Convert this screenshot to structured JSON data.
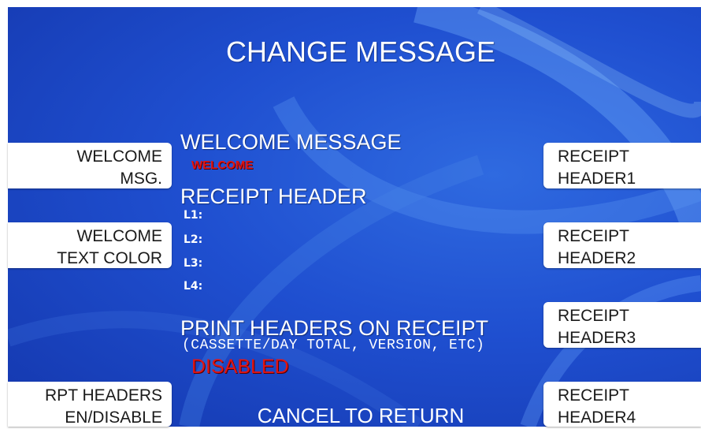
{
  "screen": {
    "title": "CHANGE MESSAGE",
    "footer": "CANCEL TO RETURN"
  },
  "welcome": {
    "heading": "WELCOME MESSAGE",
    "value": "WELCOME"
  },
  "receipt_header": {
    "heading": "RECEIPT HEADER",
    "lines": [
      "L1:",
      "L2:",
      "L3:",
      "L4:"
    ]
  },
  "print_headers": {
    "heading": "PRINT HEADERS ON RECEIPT",
    "subtext": "(CASSETTE/DAY TOTAL, VERSION, ETC)",
    "status": "DISABLED"
  },
  "left_keys": [
    {
      "line1": "WELCOME",
      "line2": "MSG."
    },
    {
      "line1": "WELCOME",
      "line2": "TEXT COLOR"
    },
    {
      "line1": "RPT HEADERS",
      "line2": "EN/DISABLE"
    }
  ],
  "right_keys": [
    {
      "line1": "RECEIPT",
      "line2": "HEADER1"
    },
    {
      "line1": "RECEIPT",
      "line2": "HEADER2"
    },
    {
      "line1": "RECEIPT",
      "line2": "HEADER3"
    },
    {
      "line1": "RECEIPT",
      "line2": "HEADER4"
    }
  ],
  "colors": {
    "background": "#1f4fd0",
    "status_red": "#e01515",
    "key_background": "#ffffff"
  }
}
